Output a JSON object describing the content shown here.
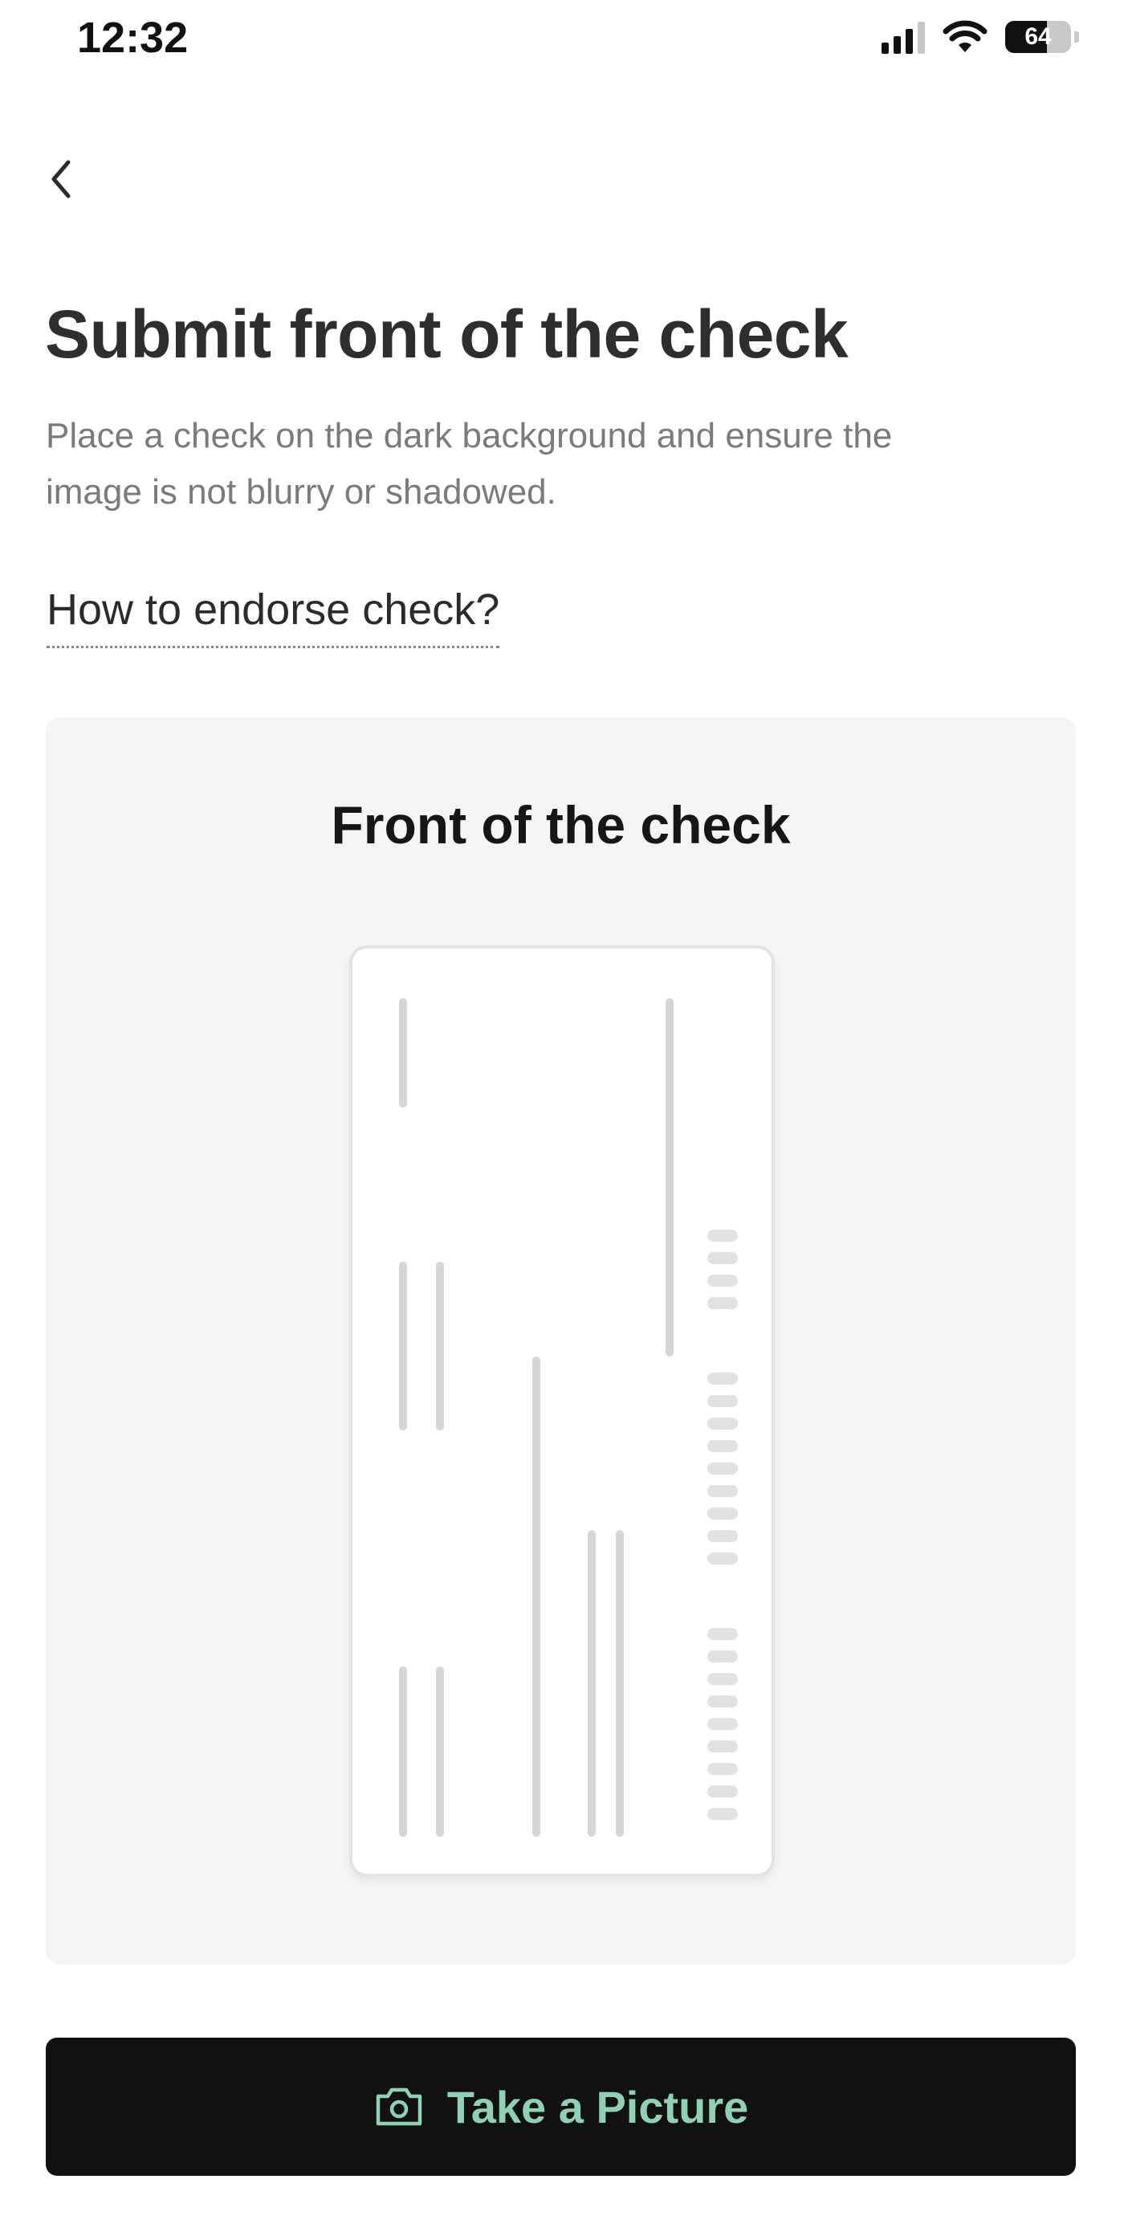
{
  "status_bar": {
    "time": "12:32",
    "battery_level": 0.64,
    "battery_text": "64",
    "wifi": "wifi-icon",
    "signal": "signal-icon"
  },
  "header": {
    "back_icon": "chevron-left-icon"
  },
  "page": {
    "title": "Submit front of the check",
    "subtitle_line1": "Place a check on the dark background and ensure the",
    "subtitle_line2": "image is not blurry or shadowed.",
    "endorse_link": "How to endorse check?"
  },
  "card": {
    "title": "Front of the check",
    "illustration": "check-front-illustration"
  },
  "action": {
    "button_label": "Take a Picture",
    "button_icon": "camera-icon"
  },
  "colors": {
    "button_bg": "#111111",
    "button_text": "#8fd1b5",
    "card_bg": "#f5f5f5"
  }
}
